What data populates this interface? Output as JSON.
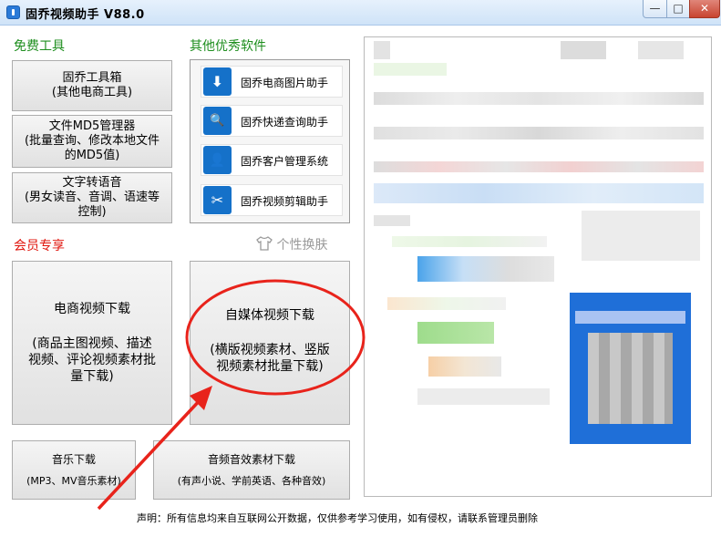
{
  "window": {
    "title": "固乔视频助手 V88.0",
    "min_glyph": "—",
    "max_glyph": "□",
    "close_glyph": "✕"
  },
  "free_tools": {
    "heading": "免费工具",
    "toolbox": {
      "line1": "固乔工具箱",
      "line2": "(其他电商工具)"
    },
    "md5": {
      "line1": "文件MD5管理器",
      "line2": "(批量查询、修改本地文件",
      "line3": "的MD5值)"
    },
    "tts": {
      "line1": "文字转语音",
      "line2": "(男女读音、音调、语速等",
      "line3": "控制)"
    }
  },
  "other_software": {
    "heading": "其他优秀软件",
    "items": [
      {
        "label": "固乔电商图片助手",
        "icon": "download-icon",
        "glyph": "⬇"
      },
      {
        "label": "固乔快递查询助手",
        "icon": "search-icon",
        "glyph": "🔍"
      },
      {
        "label": "固乔客户管理系统",
        "icon": "user-icon",
        "glyph": "👤"
      },
      {
        "label": "固乔视频剪辑助手",
        "icon": "scissors-icon",
        "glyph": "✂"
      }
    ]
  },
  "vip": {
    "heading": "会员专享",
    "skin_label": "个性换肤",
    "skin_icon": "shirt-icon",
    "ecommerce": {
      "line1": "电商视频下载",
      "line2": "(商品主图视频、描述",
      "line3": "视频、评论视频素材批",
      "line4": "量下载)"
    },
    "media": {
      "line1": "自媒体视频下载",
      "line2": "(横版视频素材、竖版",
      "line3": "视频素材批量下载)"
    },
    "music": {
      "line1": "音乐下载",
      "line2": "(MP3、MV音乐素材)"
    },
    "audio": {
      "line1": "音频音效素材下载",
      "line2": "(有声小说、学前英语、各种音效)"
    }
  },
  "footer": {
    "notice": "声明：所有信息均来自互联网公开数据，仅供参考学习使用，如有侵权，请联系管理员删除"
  },
  "colors": {
    "section_green": "#1e8e1e",
    "section_red": "#e0140c",
    "annotation_red": "#e8231b",
    "icon_blue": "#1571c9"
  }
}
